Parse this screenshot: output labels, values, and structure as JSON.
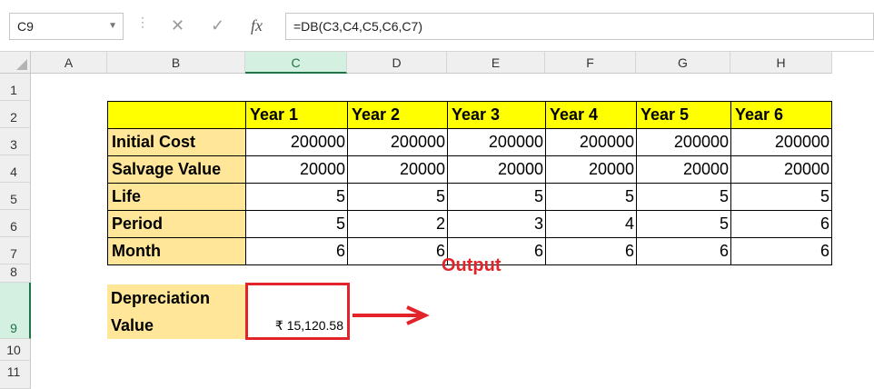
{
  "name_box": "C9",
  "formula": "=DB(C3,C4,C5,C6,C7)",
  "fx_label": "fx",
  "columns": [
    "A",
    "B",
    "C",
    "D",
    "E",
    "F",
    "G",
    "H"
  ],
  "rows": [
    "1",
    "2",
    "3",
    "4",
    "5",
    "6",
    "7",
    "8",
    "9",
    "10",
    "11"
  ],
  "year_headers": [
    "Year 1",
    "Year 2",
    "Year 3",
    "Year 4",
    "Year 5",
    "Year 6"
  ],
  "labels": {
    "initial_cost": "Initial Cost",
    "salvage": "Salvage Value",
    "life": "Life",
    "period": "Period",
    "month": "Month",
    "dep_line1": "Depreciation",
    "dep_line2": "Value"
  },
  "values": {
    "initial_cost": [
      "200000",
      "200000",
      "200000",
      "200000",
      "200000",
      "200000"
    ],
    "salvage": [
      "20000",
      "20000",
      "20000",
      "20000",
      "20000",
      "20000"
    ],
    "life": [
      "5",
      "5",
      "5",
      "5",
      "5",
      "5"
    ],
    "period": [
      "5",
      "2",
      "3",
      "4",
      "5",
      "6"
    ],
    "month": [
      "6",
      "6",
      "6",
      "6",
      "6",
      "6"
    ]
  },
  "result": "₹ 15,120.58",
  "output_label": "Output",
  "colors": {
    "header_yellow": "#ffff00",
    "label_gold": "#ffe699",
    "accent_red": "#e2242a",
    "excel_green": "#217346"
  }
}
